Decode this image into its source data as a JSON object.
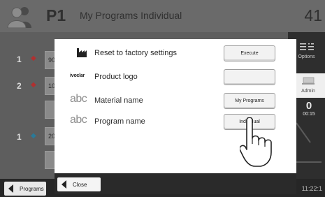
{
  "header": {
    "program_id": "P1",
    "title": "My Programs Individual",
    "program_number": "41"
  },
  "background_rows": [
    {
      "number": "1",
      "cell": "90"
    },
    {
      "number": "2",
      "cell": "10"
    },
    {
      "number": "1",
      "cell": "20"
    }
  ],
  "side_panel": {
    "options_label": "Options",
    "admin_label": "Admin",
    "timer_value": "0",
    "timer_time": "00:15"
  },
  "footer": {
    "programs_label": "Programs",
    "clock": "11:22:1"
  },
  "dialog": {
    "rows": [
      {
        "icon": "factory-icon",
        "label": "Reset to factory settings",
        "button": "Execute"
      },
      {
        "icon": "ivoclar-logo",
        "logo_text": "ivoclar",
        "label": "Product logo",
        "button": ""
      },
      {
        "icon": "abc-icon",
        "abc_text": "abc",
        "label": "Material name",
        "button": "My Programs"
      },
      {
        "icon": "abc-icon",
        "abc_text": "abc",
        "label": "Program name",
        "button": "Individual"
      }
    ],
    "close_label": "Close"
  },
  "colors": {
    "header_bg": "#6a6a6a",
    "dialog_bg": "#ffffff",
    "marker_red": "#b03030",
    "marker_blue": "#2a7a99"
  }
}
